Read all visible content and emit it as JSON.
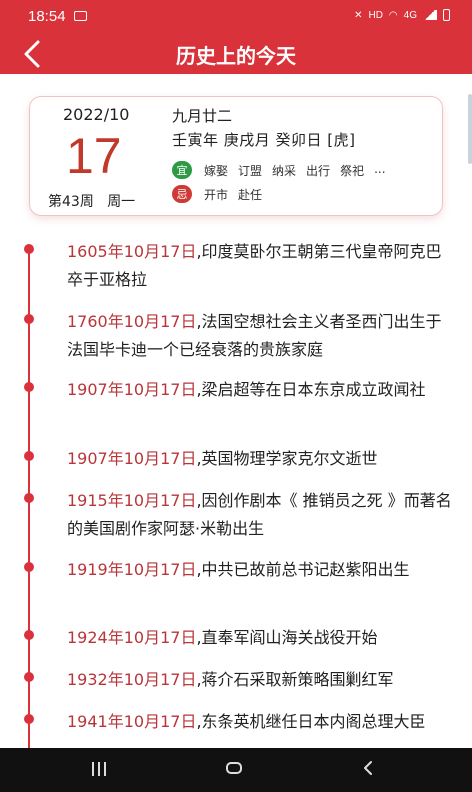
{
  "status_bar": {
    "time": "18:54",
    "network": "HD",
    "cellular": "4G"
  },
  "header": {
    "title": "历史上的今天"
  },
  "date_card": {
    "year_month": "2022/10",
    "day": "17",
    "week": "第43周",
    "weekday": "周一",
    "lunar_date": "九月廿二",
    "ganzhi": "壬寅年 庚戌月 癸卯日 [虎]",
    "yi_label": "宜",
    "yi_activities": [
      "嫁娶",
      "订盟",
      "纳采",
      "出行",
      "祭祀",
      "..."
    ],
    "ji_label": "忌",
    "ji_activities": [
      "开市",
      "赴任"
    ]
  },
  "events": [
    {
      "date": "1605年10月17日",
      "text": ",印度莫卧尔王朝第三代皇帝阿克巴卒于亚格拉"
    },
    {
      "date": "1760年10月17日",
      "text": ",法国空想社会主义者圣西门出生于法国毕卡迪一个已经衰落的贵族家庭"
    },
    {
      "date": "1907年10月17日",
      "text": ",梁启超等在日本东京成立政闻社"
    },
    {
      "date": "1907年10月17日",
      "text": ",英国物理学家克尔文逝世"
    },
    {
      "date": "1915年10月17日",
      "text": ",因创作剧本《 推销员之死 》而著名的美国剧作家阿瑟·米勒出生"
    },
    {
      "date": "1919年10月17日",
      "text": ",中共已故前总书记赵紫阳出生"
    },
    {
      "date": "1924年10月17日",
      "text": ",直奉军阎山海关战役开始"
    },
    {
      "date": "1932年10月17日",
      "text": ",蒋介石采取新策略围剿红军"
    },
    {
      "date": "1941年10月17日",
      "text": ",东条英机继任日本内阁总理大臣"
    }
  ],
  "colors": {
    "primary": "#d9323b",
    "date_text": "#b8353a",
    "yi_badge": "#2e9a45",
    "ji_badge": "#d03a36"
  }
}
